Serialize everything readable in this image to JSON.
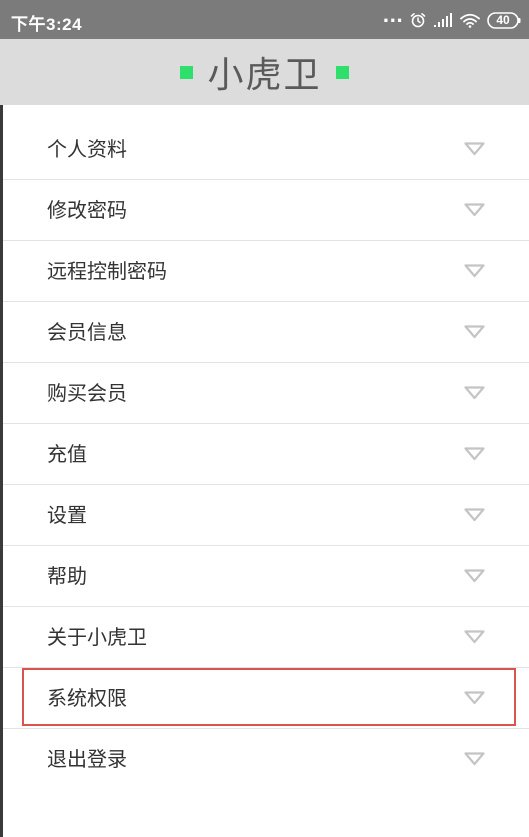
{
  "status_bar": {
    "time": "下午3:24",
    "dots": "...",
    "battery": "40",
    "icons": [
      "alarm-icon",
      "signal-icon",
      "wifi-icon",
      "battery-icon"
    ]
  },
  "header": {
    "title": "小虎卫",
    "accent_color": "#2ee06b"
  },
  "menu": {
    "items": [
      {
        "label": "个人资料"
      },
      {
        "label": "修改密码"
      },
      {
        "label": "远程控制密码"
      },
      {
        "label": "会员信息"
      },
      {
        "label": "购买会员"
      },
      {
        "label": "充值"
      },
      {
        "label": "设置"
      },
      {
        "label": "帮助"
      },
      {
        "label": "关于小虎卫"
      },
      {
        "label": "系统权限",
        "highlighted": true
      },
      {
        "label": "退出登录"
      }
    ]
  },
  "highlight_color": "#d9534f"
}
